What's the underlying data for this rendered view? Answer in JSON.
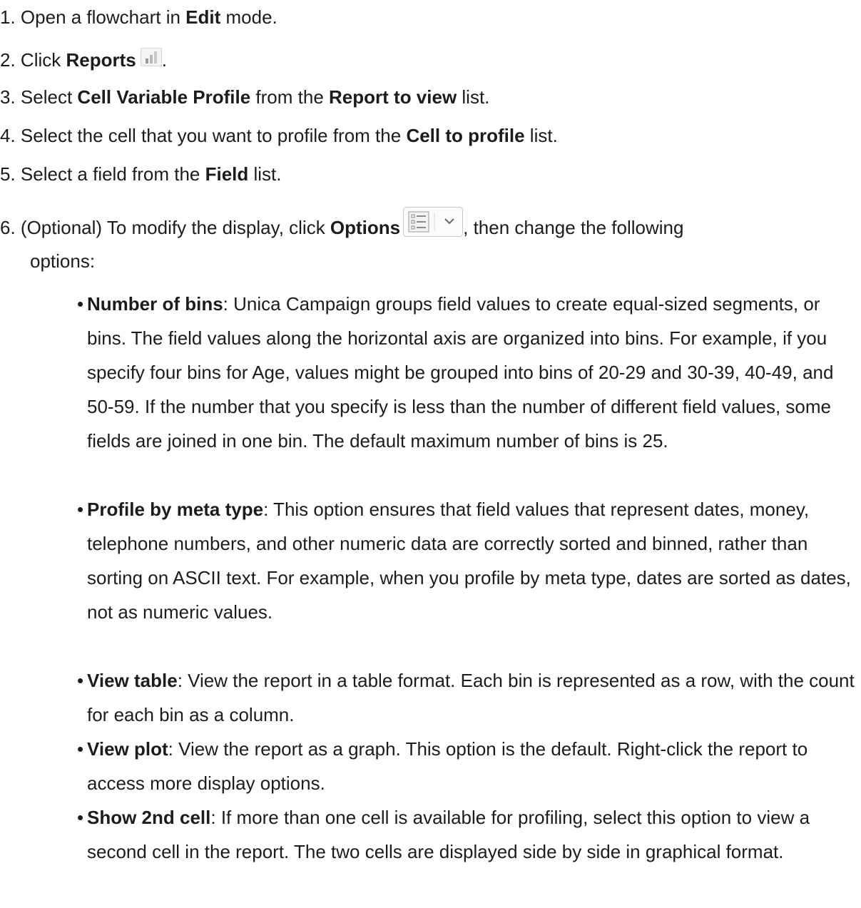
{
  "steps": [
    {
      "num": "1.",
      "pre": "Open a flowchart in ",
      "b1": "Edit",
      "post": " mode."
    },
    {
      "num": "2.",
      "pre": "Click ",
      "b1": "Reports",
      "post": "."
    },
    {
      "num": "3.",
      "pre": "Select ",
      "b1": "Cell Variable Profile",
      "mid": " from the ",
      "b2": "Report to view",
      "post": " list."
    },
    {
      "num": "4.",
      "pre": "Select the cell that you want to profile from the ",
      "b1": "Cell to profile",
      "post": " list."
    },
    {
      "num": "5.",
      "pre": "Select a field from the ",
      "b1": "Field",
      "post": " list."
    },
    {
      "num": "6.",
      "pre": "(Optional) To modify the display, click ",
      "b1": "Options",
      "post": ", then change the following",
      "cont": "options:"
    }
  ],
  "options": [
    {
      "term": "Number of bins",
      "text": ": Unica Campaign groups field values to create equal-sized segments, or bins. The field values along the horizontal axis are organized into bins. For example, if you specify four bins for Age, values might be grouped into bins of 20-29 and 30-39, 40-49, and 50-59. If the number that you specify is less than the number of different field values, some fields are joined in one bin. The default maximum number of bins is 25."
    },
    {
      "term": "Profile by meta type",
      "text": ": This option ensures that field values that represent dates, money, telephone numbers, and other numeric data are correctly sorted and binned, rather than sorting on ASCII text. For example, when you profile by meta type, dates are sorted as dates, not as numeric values."
    },
    {
      "term": "View table",
      "text": ": View the report in a table format. Each bin is represented as a row, with the count for each bin as a column."
    },
    {
      "term": "View plot",
      "text": ": View the report as a graph. This option is the default. Right-click the report to access more display options."
    },
    {
      "term": "Show 2nd cell",
      "text": ": If more than one cell is available for profiling, select this option to view a second cell in the report. The two cells are displayed side by side in graphical format."
    }
  ],
  "icons": {
    "reports": "reports-icon",
    "options": "options-icon"
  },
  "colors": {
    "text": "#1c1c1c"
  }
}
